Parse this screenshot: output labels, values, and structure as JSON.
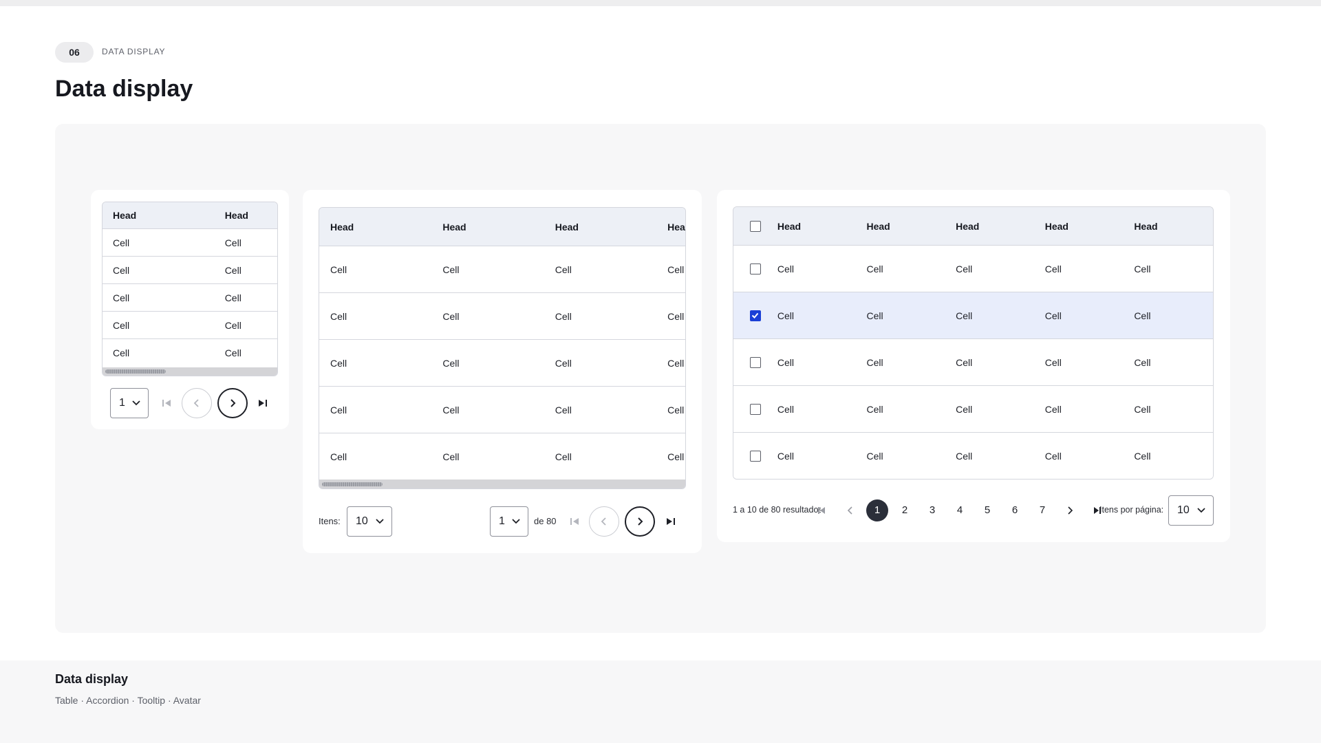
{
  "header": {
    "badge": "06",
    "section_label": "DATA DISPLAY",
    "title": "Data display"
  },
  "table_small": {
    "headers": [
      "Head",
      "Head"
    ],
    "rows": [
      [
        "Cell",
        "Cell"
      ],
      [
        "Cell",
        "Cell"
      ],
      [
        "Cell",
        "Cell"
      ],
      [
        "Cell",
        "Cell"
      ],
      [
        "Cell",
        "Cell"
      ]
    ],
    "page_select_value": "1"
  },
  "table_medium": {
    "headers": [
      "Head",
      "Head",
      "Head",
      "Head"
    ],
    "rows": [
      [
        "Cell",
        "Cell",
        "Cell",
        "Cell"
      ],
      [
        "Cell",
        "Cell",
        "Cell",
        "Cell"
      ],
      [
        "Cell",
        "Cell",
        "Cell",
        "Cell"
      ],
      [
        "Cell",
        "Cell",
        "Cell",
        "Cell"
      ],
      [
        "Cell",
        "Cell",
        "Cell",
        "Cell"
      ]
    ],
    "items_label": "Itens:",
    "items_value": "10",
    "page_select_value": "1",
    "page_of_label": "de 80"
  },
  "table_large": {
    "headers": [
      "Head",
      "Head",
      "Head",
      "Head",
      "Head"
    ],
    "rows": [
      {
        "checked": false,
        "cells": [
          "Cell",
          "Cell",
          "Cell",
          "Cell",
          "Cell"
        ]
      },
      {
        "checked": true,
        "cells": [
          "Cell",
          "Cell",
          "Cell",
          "Cell",
          "Cell"
        ]
      },
      {
        "checked": false,
        "cells": [
          "Cell",
          "Cell",
          "Cell",
          "Cell",
          "Cell"
        ]
      },
      {
        "checked": false,
        "cells": [
          "Cell",
          "Cell",
          "Cell",
          "Cell",
          "Cell"
        ]
      },
      {
        "checked": false,
        "cells": [
          "Cell",
          "Cell",
          "Cell",
          "Cell",
          "Cell"
        ]
      }
    ],
    "results_label": "1 a 10 de 80 resultados",
    "pages": [
      "1",
      "2",
      "3",
      "4",
      "5",
      "6",
      "7"
    ],
    "current_page": "1",
    "per_page_label": "Itens por página:",
    "per_page_value": "10"
  },
  "footer": {
    "title": "Data display",
    "subtitle": "Table · Accordion · Tooltip · Avatar"
  },
  "colors": {
    "accent": "#1a3fd6",
    "header_bg": "#edf0f6",
    "selected_row_bg": "#e8edfb",
    "current_page_bg": "#2b2f3a"
  },
  "icons": [
    "chevron-down-icon",
    "first-page-icon",
    "chevron-left-icon",
    "chevron-right-icon",
    "last-page-icon",
    "checkbox-icon",
    "check-icon"
  ]
}
